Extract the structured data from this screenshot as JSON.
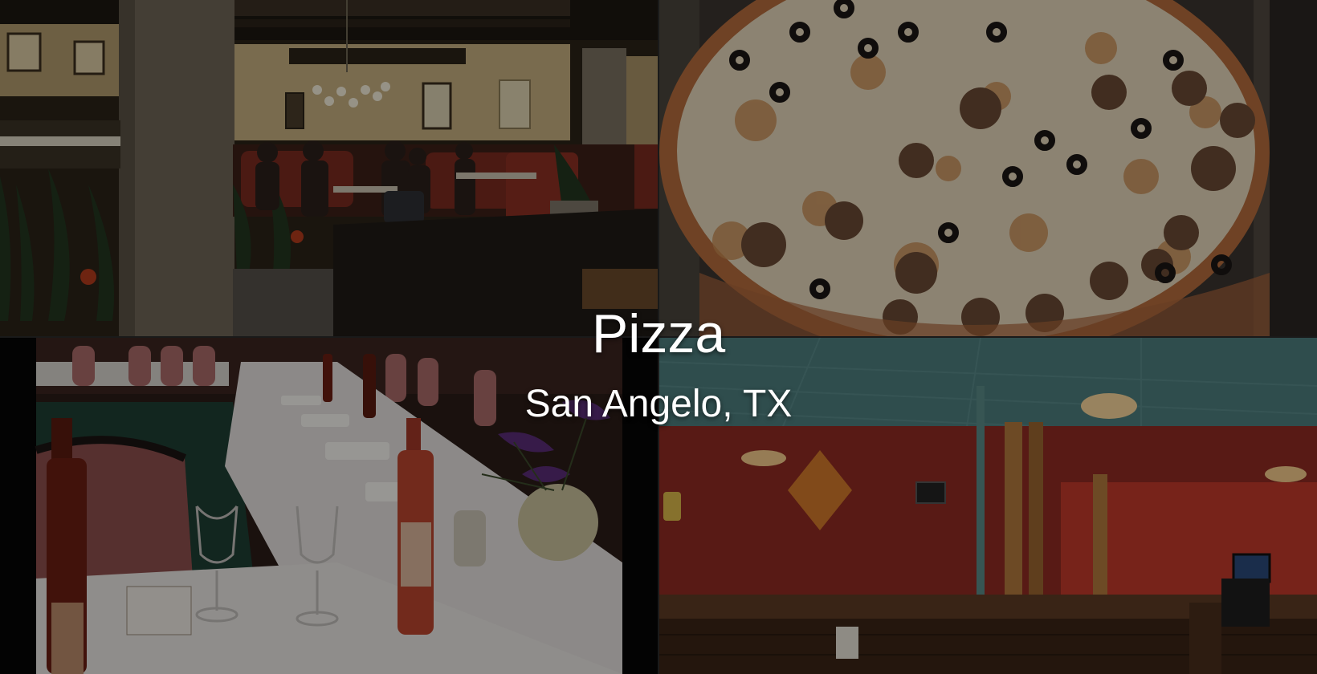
{
  "overlay": {
    "title": "Pizza",
    "subtitle": "San Angelo, TX"
  },
  "photos": [
    {
      "id": "dining-room-booths",
      "icon": "photo-icon"
    },
    {
      "id": "pizza-closeup",
      "icon": "photo-icon"
    },
    {
      "id": "banquet-table",
      "icon": "photo-icon"
    },
    {
      "id": "sports-bar-interior",
      "icon": "photo-icon"
    }
  ],
  "colors": {
    "text": "#ffffff",
    "overlay_dim": "rgba(0,0,0,0.38)",
    "wall_beige": "#c9b48a",
    "pizza_cheese": "#e9dcc5",
    "pizza_crust": "#b06a3a",
    "bar_red": "#8e2a22",
    "ceiling_teal": "#3f6d6e",
    "tablecloth": "#e6e3de",
    "wine_red": "#7a1d12"
  }
}
